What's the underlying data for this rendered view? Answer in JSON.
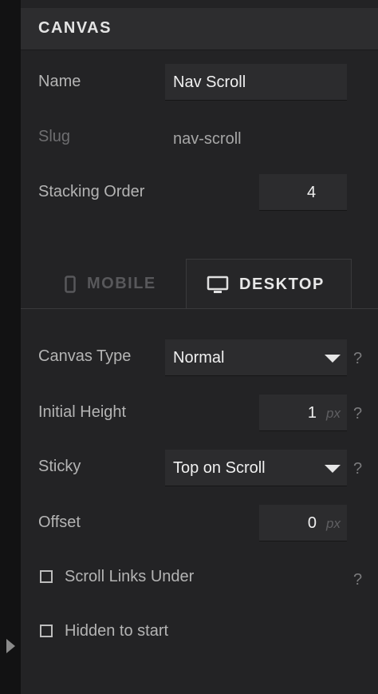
{
  "header": {
    "title": "CANVAS"
  },
  "fields": {
    "name": {
      "label": "Name",
      "value": "Nav Scroll"
    },
    "slug": {
      "label": "Slug",
      "value": "nav-scroll"
    },
    "stacking_order": {
      "label": "Stacking Order",
      "value": "4"
    }
  },
  "tabs": {
    "mobile": {
      "label": "MOBILE",
      "icon": "phone-icon",
      "active": false
    },
    "desktop": {
      "label": "DESKTOP",
      "icon": "monitor-icon",
      "active": true
    }
  },
  "desktop": {
    "canvas_type": {
      "label": "Canvas Type",
      "value": "Normal",
      "help": "?"
    },
    "initial_height": {
      "label": "Initial Height",
      "value": "1",
      "unit": "px",
      "help": "?"
    },
    "sticky": {
      "label": "Sticky",
      "value": "Top on Scroll",
      "help": "?"
    },
    "offset": {
      "label": "Offset",
      "value": "0",
      "unit": "px"
    },
    "scroll_links_under": {
      "label": "Scroll Links Under",
      "checked": false,
      "help": "?"
    },
    "hidden_to_start": {
      "label": "Hidden to start",
      "checked": false
    }
  },
  "colors": {
    "background": "#232325",
    "header": "#2d2d2f",
    "input": "#2c2c2e",
    "text": "#b4b4b4"
  }
}
